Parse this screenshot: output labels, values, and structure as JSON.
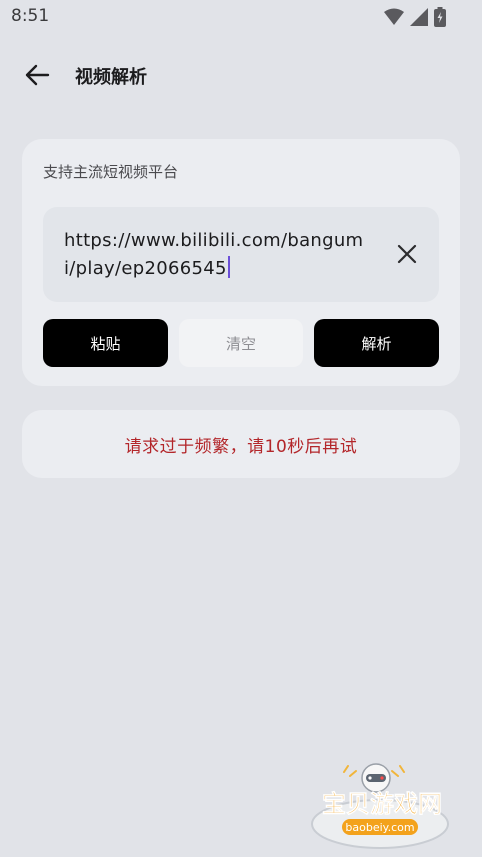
{
  "status_bar": {
    "time": "8:51"
  },
  "app_bar": {
    "title": "视频解析",
    "back_icon": "arrow-left-icon"
  },
  "card": {
    "subtitle": "支持主流短视频平台",
    "url_input": {
      "value": "https://www.bilibili.com/bangumi/play/ep2066545"
    },
    "buttons": {
      "paste": "粘贴",
      "clear": "清空",
      "parse": "解析"
    }
  },
  "message": {
    "text": "请求过于频繁，请10秒后再试",
    "color": "#b3262a"
  },
  "watermark": {
    "text": "宝贝游戏网",
    "domain": "baobeiy.com"
  },
  "colors": {
    "background": "#e1e3e8",
    "card": "#ebedf1",
    "caret": "#6b4fd8"
  }
}
